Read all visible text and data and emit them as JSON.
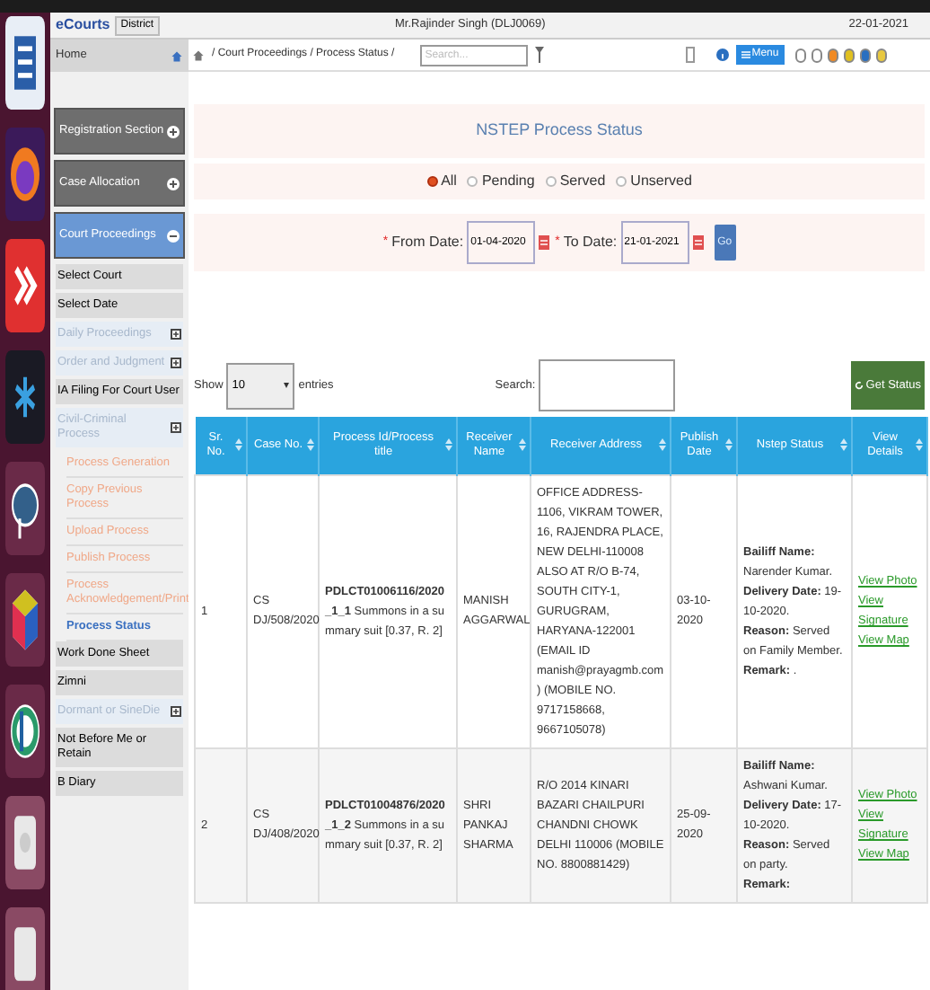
{
  "header": {
    "logo": "eCourts",
    "district_button": "District",
    "user": "Mr.Rajinder Singh (DLJ0069)",
    "date": "22-01-2021"
  },
  "toolbar": {
    "breadcrumb": "/ Court Proceedings / Process Status /",
    "search_placeholder": "Search...",
    "menu_button": "Menu",
    "theme_dots": [
      {
        "color": "#ffffff"
      },
      {
        "color": "#ffffff"
      },
      {
        "color": "#f08a24"
      },
      {
        "color": "#e0c020"
      },
      {
        "color": "#2a6fc0"
      },
      {
        "color": "#e8c840"
      }
    ]
  },
  "sidebar": {
    "home": "Home",
    "items": [
      {
        "kind": "group",
        "label": "Registration Section",
        "expanded": false
      },
      {
        "kind": "group",
        "label": "Case Allocation",
        "expanded": false
      },
      {
        "kind": "group",
        "label": "Court Proceedings",
        "expanded": true
      },
      {
        "kind": "item",
        "label": "Select Court"
      },
      {
        "kind": "item",
        "label": "Select Date"
      },
      {
        "kind": "collapsible",
        "label": "Daily Proceedings"
      },
      {
        "kind": "collapsible",
        "label": "Order and Judgment"
      },
      {
        "kind": "item",
        "label": "IA Filing For Court User"
      },
      {
        "kind": "collapsible",
        "label": "Civil-Criminal Process"
      },
      {
        "kind": "link",
        "label": "Process Generation",
        "selected": false
      },
      {
        "kind": "link",
        "label": "Copy Previous Process",
        "selected": false
      },
      {
        "kind": "link",
        "label": "Upload Process",
        "selected": false
      },
      {
        "kind": "link",
        "label": "Publish Process",
        "selected": false
      },
      {
        "kind": "link",
        "label": "Process Acknowledgement/Print",
        "selected": false
      },
      {
        "kind": "link",
        "label": "Process Status",
        "selected": true
      },
      {
        "kind": "item",
        "label": "Work Done Sheet"
      },
      {
        "kind": "item",
        "label": "Zimni"
      },
      {
        "kind": "collapsible",
        "label": "Dormant or SineDie"
      },
      {
        "kind": "item",
        "label": "Not Before Me or Retain"
      },
      {
        "kind": "item",
        "label": "B Diary"
      }
    ]
  },
  "main": {
    "title": "NSTEP Process Status",
    "radios": [
      {
        "label": "All",
        "selected": true
      },
      {
        "label": "Pending",
        "selected": false
      },
      {
        "label": "Served",
        "selected": false
      },
      {
        "label": "Unserved",
        "selected": false
      }
    ],
    "dates": [
      {
        "mark": "*",
        "label": "From Date:",
        "value": "01-04-2020"
      },
      {
        "mark": "*",
        "label": "To Date:",
        "value": "21-01-2021"
      }
    ],
    "go_button": "Go",
    "show_label": "Show",
    "page_size": "10",
    "entries_label": "entries",
    "search_label": "Search:",
    "get_status_button": "Get Status",
    "columns": [
      "Sr. No.",
      "Case No.",
      "Process Id/Process title",
      "Receiver Name",
      "Receiver Address",
      "Publish Date",
      "Nstep Status",
      "View Details"
    ],
    "rows": [
      {
        "sr": "1",
        "case_no": "CS DJ/508/2020",
        "process_id": "PDLCT01006116/2020_1_1",
        "process_title": "Summons in a summary suit [0.37, R. 2]",
        "receiver_name": "MANISH AGGARWAL",
        "receiver_address": "OFFICE ADDRESS- 1106, VIKRAM TOWER, 16, RAJENDRA PLACE, NEW DELHI-110008 ALSO AT R/O B-74, SOUTH CITY-1, GURUGRAM, HARYANA-122001 (EMAIL ID manish@prayagmb.com) (MOBILE NO. 9717158668, 9667105078)",
        "publish_date": "03-10-2020",
        "status": [
          {
            "label": "Bailiff Name:",
            "value": "Narender Kumar."
          },
          {
            "label": "Delivery Date:",
            "value": "19-10-2020."
          },
          {
            "label": "Reason:",
            "value": "Served on Family Member."
          },
          {
            "label": "Remark:",
            "value": "."
          }
        ],
        "links": [
          "View Photo",
          "View Signature",
          "View Map"
        ]
      },
      {
        "sr": "2",
        "case_no": "CS DJ/408/2020",
        "process_id": "PDLCT01004876/2020_1_2",
        "process_title": "Summons in a summary suit [0.37, R. 2]",
        "receiver_name": "SHRI PANKAJ SHARMA",
        "receiver_address": "R/O 2014 KINARI BAZARI CHAILPURI CHANDNI CHOWK DELHI 110006 (MOBILE NO. 8800881429)",
        "publish_date": "25-09-2020",
        "status": [
          {
            "label": "Bailiff Name:",
            "value": "Ashwani Kumar."
          },
          {
            "label": "Delivery Date:",
            "value": "17-10-2020."
          },
          {
            "label": "Reason:",
            "value": "Served on party."
          },
          {
            "label": "Remark:"
          }
        ],
        "links": [
          "View Photo",
          "View Signature",
          "View Map"
        ]
      }
    ]
  }
}
